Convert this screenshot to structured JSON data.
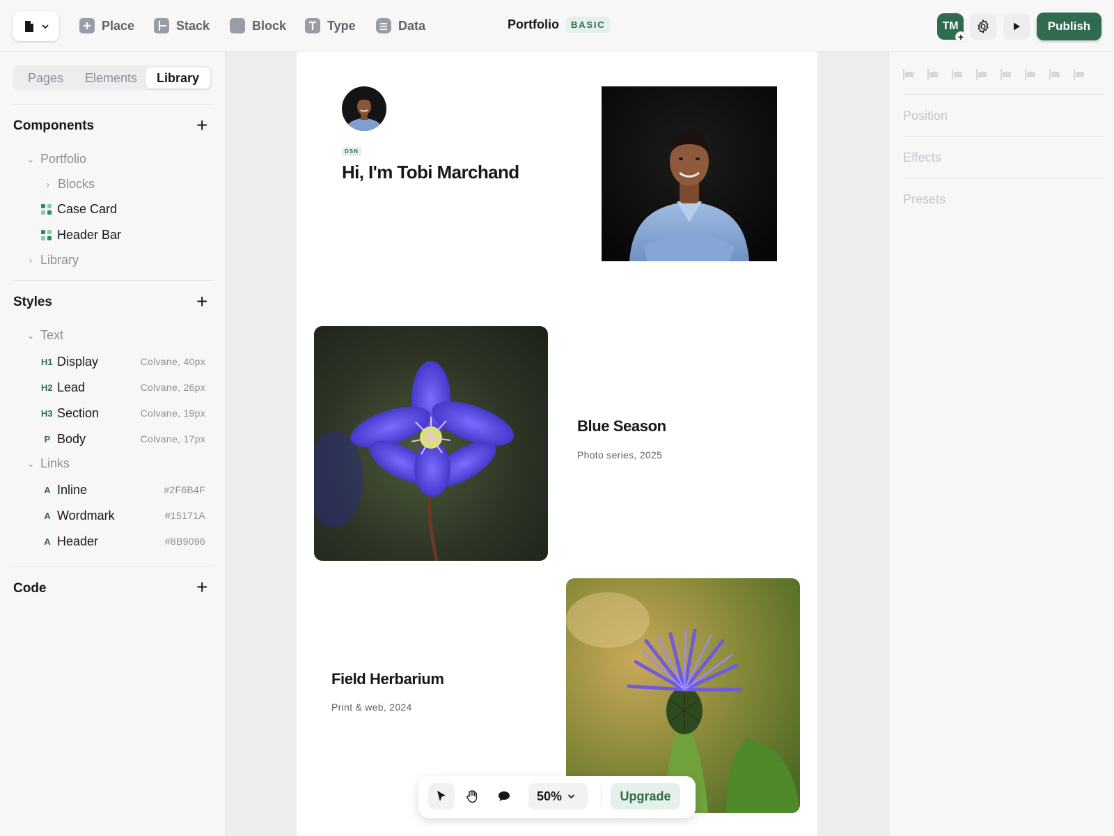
{
  "toolbar": {
    "tools": [
      {
        "label": "Place",
        "icon": "plus-square-icon"
      },
      {
        "label": "Stack",
        "icon": "stack-icon"
      },
      {
        "label": "Block",
        "icon": "block-icon"
      },
      {
        "label": "Type",
        "icon": "type-icon"
      },
      {
        "label": "Data",
        "icon": "database-icon"
      }
    ],
    "doc_title": "Portfolio",
    "plan_badge": "BASIC",
    "avatar_initials": "TM",
    "publish_label": "Publish"
  },
  "sidebar": {
    "tabs": [
      "Pages",
      "Elements",
      "Library"
    ],
    "active_tab": "Library",
    "components": {
      "heading": "Components",
      "portfolio": "Portfolio",
      "blocks": "Blocks",
      "case_card": "Case Card",
      "header_bar": "Header Bar",
      "library": "Library"
    },
    "styles": {
      "heading": "Styles",
      "text_group": "Text",
      "text_items": [
        {
          "tag": "H1",
          "label": "Display",
          "meta": "Colvane, 40px"
        },
        {
          "tag": "H2",
          "label": "Lead",
          "meta": "Colvane, 26px"
        },
        {
          "tag": "H3",
          "label": "Section",
          "meta": "Colvane, 19px"
        },
        {
          "tag": "P",
          "label": "Body",
          "meta": "Colvane, 17px"
        }
      ],
      "links_group": "Links",
      "link_items": [
        {
          "tag": "A",
          "label": "Inline",
          "meta": "#2F6B4F"
        },
        {
          "tag": "A",
          "label": "Wordmark",
          "meta": "#15171A"
        },
        {
          "tag": "A",
          "label": "Header",
          "meta": "#8B9096"
        }
      ]
    },
    "code": {
      "heading": "Code"
    }
  },
  "inspector": {
    "sections": [
      "Position",
      "Effects",
      "Presets"
    ]
  },
  "canvas": {
    "hero": {
      "badge": "DSN",
      "title": "Hi, I'm Tobi Marchand"
    },
    "projects": [
      {
        "title": "Blue Season",
        "subtitle": "Photo series, 2025"
      },
      {
        "title": "Field Herbarium",
        "subtitle": "Print & web, 2024"
      }
    ]
  },
  "bottom_bar": {
    "zoom": "50%",
    "upgrade_label": "Upgrade"
  },
  "colors": {
    "accent": "#2F6B4F",
    "text": "#15171A",
    "muted": "#8B9096"
  }
}
